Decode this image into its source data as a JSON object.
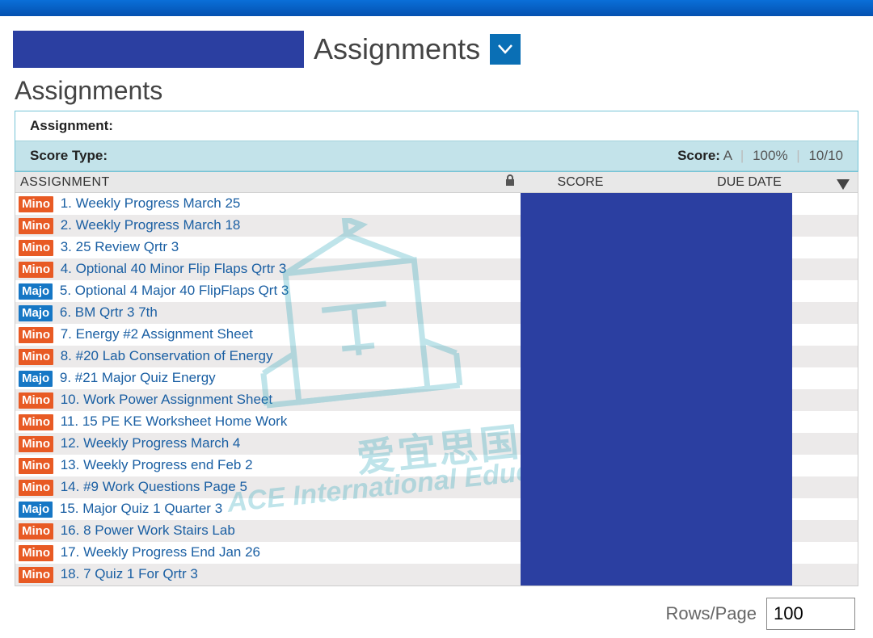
{
  "header": {
    "title": "Assignments"
  },
  "section_title": "Assignments",
  "panel": {
    "assignment_label": "Assignment:",
    "score_type_label": "Score Type:",
    "score_label": "Score:",
    "score_grade": "A",
    "score_percent": "100%",
    "score_fraction": "10/10"
  },
  "columns": {
    "assignment": "ASSIGNMENT",
    "score": "SCORE",
    "due": "DUE DATE"
  },
  "badges": {
    "minor": "Mino",
    "major": "Majo"
  },
  "rows": [
    {
      "type": "minor",
      "text": "1. Weekly Progress March 25"
    },
    {
      "type": "minor",
      "text": "2. Weekly Progress March 18"
    },
    {
      "type": "minor",
      "text": "3. 25 Review Qrtr 3"
    },
    {
      "type": "minor",
      "text": "4. Optional 40 Minor Flip Flaps Qrtr 3"
    },
    {
      "type": "major",
      "text": "5. Optional 4 Major 40 FlipFlaps Qrt 3"
    },
    {
      "type": "major",
      "text": "6. BM Qrtr 3 7th"
    },
    {
      "type": "minor",
      "text": "7. Energy #2 Assignment Sheet"
    },
    {
      "type": "minor",
      "text": "8. #20 Lab Conservation of Energy"
    },
    {
      "type": "major",
      "text": "9. #21 Major Quiz Energy"
    },
    {
      "type": "minor",
      "text": "10. Work Power Assignment Sheet"
    },
    {
      "type": "minor",
      "text": "11. 15 PE KE Worksheet Home Work"
    },
    {
      "type": "minor",
      "text": "12. Weekly Progress March 4"
    },
    {
      "type": "minor",
      "text": "13. Weekly Progress end Feb 2"
    },
    {
      "type": "minor",
      "text": "14. #9 Work Questions Page 5"
    },
    {
      "type": "major",
      "text": "15. Major Quiz 1 Quarter 3"
    },
    {
      "type": "minor",
      "text": "16. 8 Power Work Stairs Lab"
    },
    {
      "type": "minor",
      "text": "17. Weekly Progress End Jan 26"
    },
    {
      "type": "minor",
      "text": "18. 7 Quiz 1 For Qrtr 3"
    }
  ],
  "footer": {
    "rows_per_page_label": "Rows/Page",
    "rows_per_page_value": "100"
  },
  "watermark": {
    "cn": "爱宜思国际教育",
    "en": "ACE International Education"
  }
}
